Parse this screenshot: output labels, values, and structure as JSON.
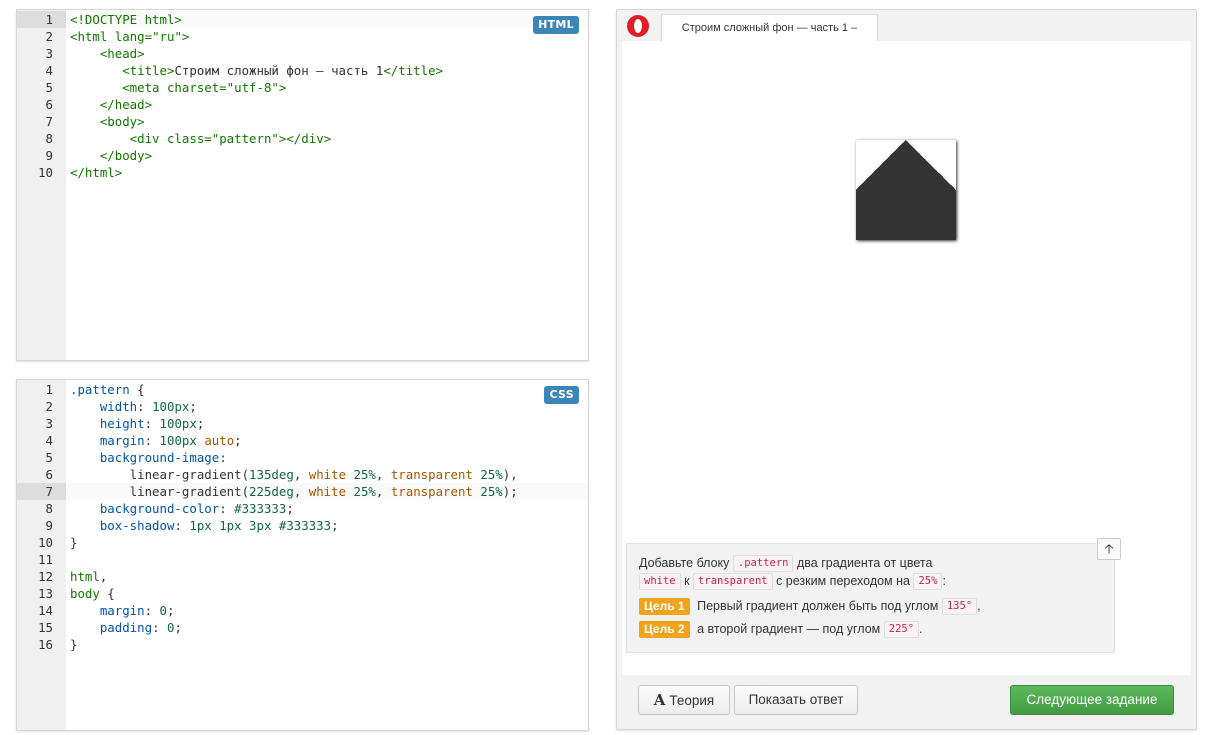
{
  "html_editor": {
    "badge": "HTML",
    "lines": [
      {
        "n": "1",
        "active": true,
        "parts": [
          {
            "t": "<!DOCTYPE html>",
            "c": "t-tag"
          }
        ]
      },
      {
        "n": "2",
        "parts": [
          {
            "t": "<html lang=",
            "c": "t-tag"
          },
          {
            "t": "\"ru\"",
            "c": "t-str"
          },
          {
            "t": ">",
            "c": "t-tag"
          }
        ]
      },
      {
        "n": "3",
        "parts": [
          {
            "t": "    <head>",
            "c": "t-tag"
          }
        ]
      },
      {
        "n": "4",
        "parts": [
          {
            "t": "       <title>",
            "c": "t-tag"
          },
          {
            "t": "Строим сложный фон – часть 1",
            "c": ""
          },
          {
            "t": "</title>",
            "c": "t-tag"
          }
        ]
      },
      {
        "n": "5",
        "parts": [
          {
            "t": "       <meta charset=",
            "c": "t-tag"
          },
          {
            "t": "\"utf-8\"",
            "c": "t-str"
          },
          {
            "t": ">",
            "c": "t-tag"
          }
        ]
      },
      {
        "n": "6",
        "parts": [
          {
            "t": "    </head>",
            "c": "t-tag"
          }
        ]
      },
      {
        "n": "7",
        "parts": [
          {
            "t": "    <body>",
            "c": "t-tag"
          }
        ]
      },
      {
        "n": "8",
        "parts": [
          {
            "t": "        <div class=",
            "c": "t-tag"
          },
          {
            "t": "\"pattern\"",
            "c": "t-str"
          },
          {
            "t": "></div>",
            "c": "t-tag"
          }
        ]
      },
      {
        "n": "9",
        "parts": [
          {
            "t": "    </body>",
            "c": "t-tag"
          }
        ]
      },
      {
        "n": "10",
        "parts": [
          {
            "t": "</html>",
            "c": "t-tag"
          }
        ]
      }
    ]
  },
  "css_editor": {
    "badge": "CSS",
    "lines": [
      {
        "n": "1",
        "parts": [
          {
            "t": ".pattern",
            "c": "t-sel"
          },
          {
            "t": " {",
            "c": ""
          }
        ]
      },
      {
        "n": "2",
        "parts": [
          {
            "t": "    width",
            "c": "t-prop"
          },
          {
            "t": ": ",
            "c": ""
          },
          {
            "t": "100px",
            "c": "t-num"
          },
          {
            "t": ";",
            "c": ""
          }
        ]
      },
      {
        "n": "3",
        "parts": [
          {
            "t": "    height",
            "c": "t-prop"
          },
          {
            "t": ": ",
            "c": ""
          },
          {
            "t": "100px",
            "c": "t-num"
          },
          {
            "t": ";",
            "c": ""
          }
        ]
      },
      {
        "n": "4",
        "parts": [
          {
            "t": "    margin",
            "c": "t-prop"
          },
          {
            "t": ": ",
            "c": ""
          },
          {
            "t": "100px",
            "c": "t-num"
          },
          {
            "t": " ",
            "c": ""
          },
          {
            "t": "auto",
            "c": "t-kw"
          },
          {
            "t": ";",
            "c": ""
          }
        ]
      },
      {
        "n": "5",
        "parts": [
          {
            "t": "    background-image",
            "c": "t-prop"
          },
          {
            "t": ":",
            "c": ""
          }
        ]
      },
      {
        "n": "6",
        "parts": [
          {
            "t": "        linear-gradient(",
            "c": ""
          },
          {
            "t": "135deg",
            "c": "t-num"
          },
          {
            "t": ", ",
            "c": ""
          },
          {
            "t": "white",
            "c": "t-kw"
          },
          {
            "t": " ",
            "c": ""
          },
          {
            "t": "25%",
            "c": "t-num"
          },
          {
            "t": ", ",
            "c": ""
          },
          {
            "t": "transparent",
            "c": "t-kw"
          },
          {
            "t": " ",
            "c": ""
          },
          {
            "t": "25%",
            "c": "t-num"
          },
          {
            "t": "),",
            "c": ""
          }
        ]
      },
      {
        "n": "7",
        "active": true,
        "parts": [
          {
            "t": "        linear-gradient(",
            "c": ""
          },
          {
            "t": "225deg",
            "c": "t-num"
          },
          {
            "t": ", ",
            "c": ""
          },
          {
            "t": "white",
            "c": "t-kw"
          },
          {
            "t": " ",
            "c": ""
          },
          {
            "t": "25%",
            "c": "t-num"
          },
          {
            "t": ", ",
            "c": ""
          },
          {
            "t": "transparent",
            "c": "t-kw"
          },
          {
            "t": " ",
            "c": ""
          },
          {
            "t": "25%",
            "c": "t-num"
          },
          {
            "t": ");",
            "c": ""
          }
        ]
      },
      {
        "n": "8",
        "parts": [
          {
            "t": "    background-color",
            "c": "t-prop"
          },
          {
            "t": ": ",
            "c": ""
          },
          {
            "t": "#333333",
            "c": "t-num"
          },
          {
            "t": ";",
            "c": ""
          }
        ]
      },
      {
        "n": "9",
        "parts": [
          {
            "t": "    box-shadow",
            "c": "t-prop"
          },
          {
            "t": ": ",
            "c": ""
          },
          {
            "t": "1px 1px 3px #333333",
            "c": "t-num"
          },
          {
            "t": ";",
            "c": ""
          }
        ]
      },
      {
        "n": "10",
        "parts": [
          {
            "t": "}",
            "c": ""
          }
        ]
      },
      {
        "n": "11",
        "parts": []
      },
      {
        "n": "12",
        "parts": [
          {
            "t": "html",
            "c": "t-tag"
          },
          {
            "t": ",",
            "c": ""
          }
        ]
      },
      {
        "n": "13",
        "parts": [
          {
            "t": "body",
            "c": "t-tag"
          },
          {
            "t": " {",
            "c": ""
          }
        ]
      },
      {
        "n": "14",
        "parts": [
          {
            "t": "    margin",
            "c": "t-prop"
          },
          {
            "t": ": ",
            "c": ""
          },
          {
            "t": "0",
            "c": "t-num"
          },
          {
            "t": ";",
            "c": ""
          }
        ]
      },
      {
        "n": "15",
        "parts": [
          {
            "t": "    padding",
            "c": "t-prop"
          },
          {
            "t": ": ",
            "c": ""
          },
          {
            "t": "0",
            "c": "t-num"
          },
          {
            "t": ";",
            "c": ""
          }
        ]
      },
      {
        "n": "16",
        "parts": [
          {
            "t": "}",
            "c": ""
          }
        ]
      }
    ]
  },
  "preview": {
    "browser_icon": "opera-logo-icon",
    "tab_title": "Строим сложный фон — часть 1 –",
    "pattern_color": "#333333"
  },
  "task": {
    "line1_prefix": "Добавьте блоку",
    "line1_code": ".pattern",
    "line1_suffix": "два градиента от цвета",
    "line2_code_a": "white",
    "line2_mid": "к",
    "line2_code_b": "transparent",
    "line2_text": "с резким переходом на",
    "line2_code_c": "25%",
    "line2_end": ":",
    "goal1_badge": "Цель 1",
    "goal1_text": "Первый градиент должен быть под углом",
    "goal1_code": "135°",
    "goal1_end": ",",
    "goal2_badge": "Цель 2",
    "goal2_text": "а второй градиент — под углом",
    "goal2_code": "225°",
    "goal2_end": ".",
    "toggle_icon": "arrow-up-icon"
  },
  "buttons": {
    "theory_icon": "A",
    "theory_label": "Теория",
    "answer_label": "Показать ответ",
    "next_label": "Следующее задание",
    "next_color": "#5cb85c"
  }
}
